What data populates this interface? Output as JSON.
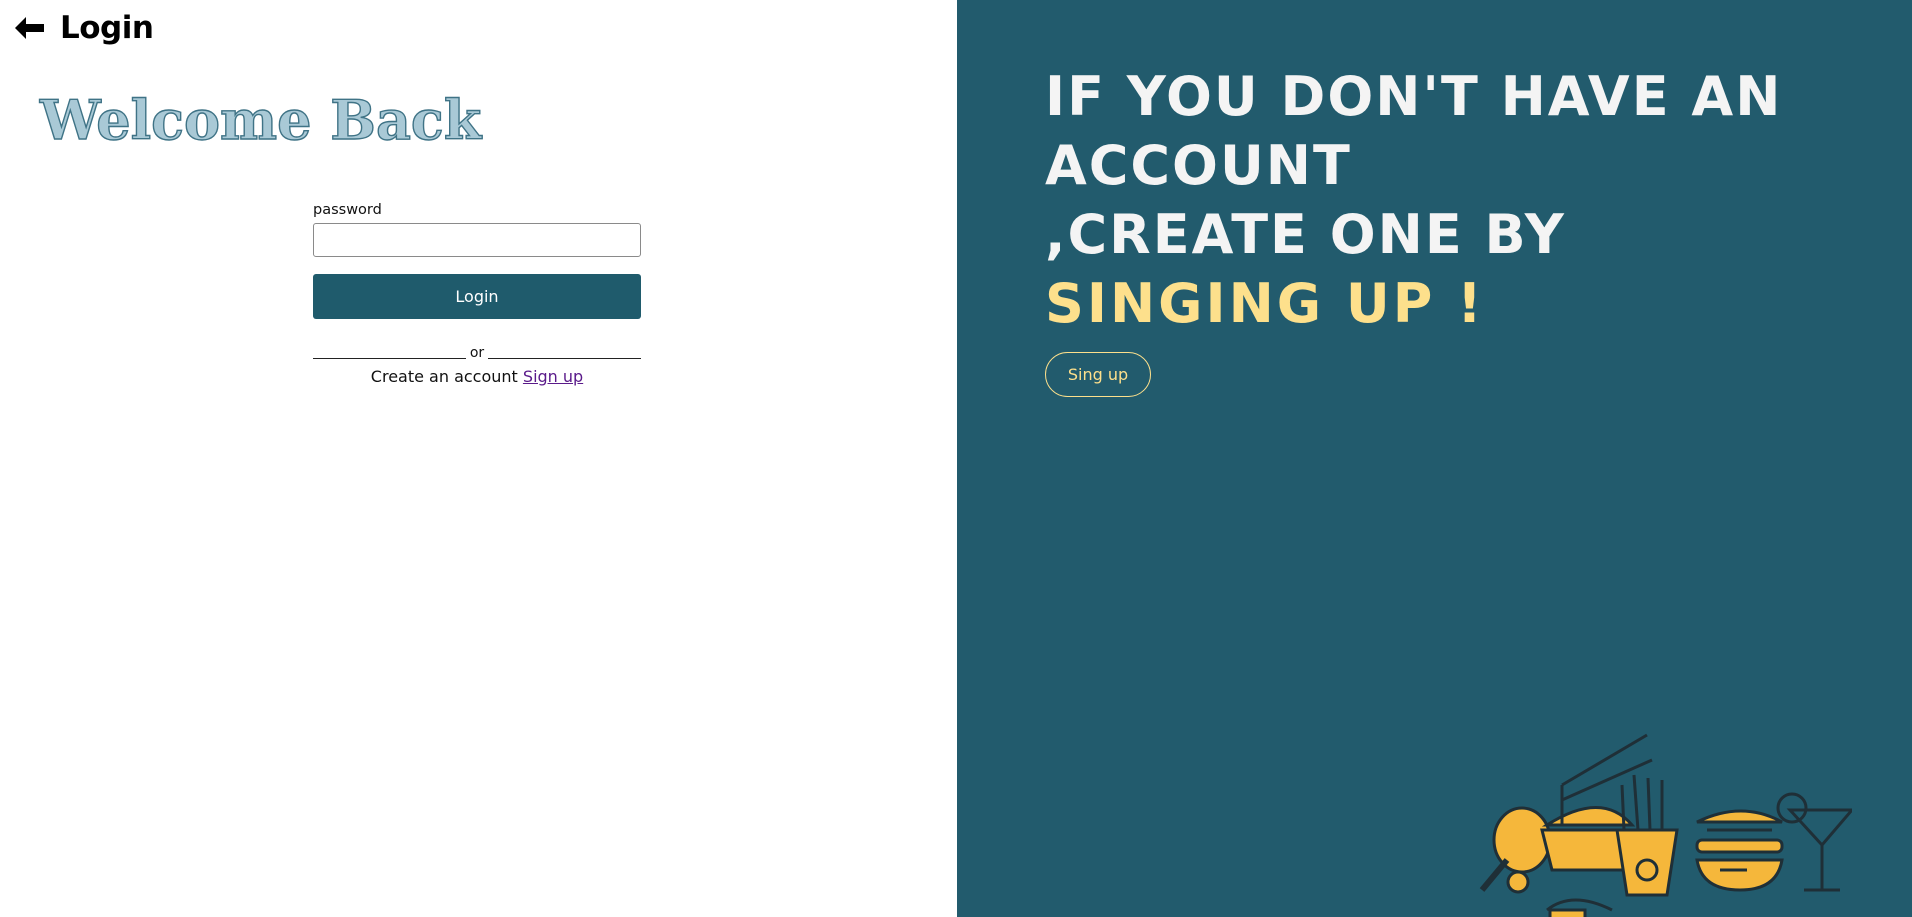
{
  "header": {
    "title": "Login",
    "back_icon": "arrow-left-icon"
  },
  "welcome": "Welcome Back",
  "form": {
    "password_label": "password",
    "password_value": "",
    "login_button": "Login",
    "divider_text": "or",
    "create_text": "Create an account",
    "signup_link": "Sign up"
  },
  "promo": {
    "line1": "IF YOU DON'T HAVE AN",
    "line2": "ACCOUNT",
    "line3": ",CREATE ONE BY",
    "line4": "SINGING UP !",
    "button": "Sing up",
    "illustration_icon": "food-illustration-icon"
  },
  "colors": {
    "panel": "#225b6d",
    "accent": "#fde08c",
    "button": "#1f5b6c",
    "link": "#5a1a8a"
  }
}
